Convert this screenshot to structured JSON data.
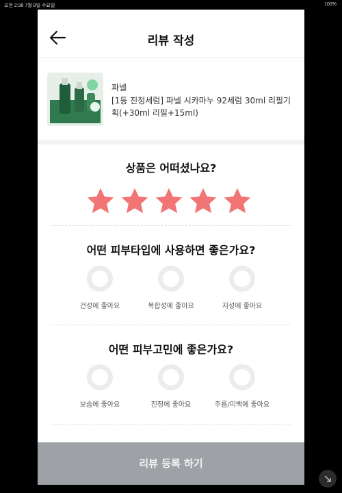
{
  "status_bar": {
    "left": "오전 2:36  7월 8일 수요일",
    "right": "100%"
  },
  "header": {
    "title": "리뷰 작성"
  },
  "product": {
    "brand": "파넬",
    "name": "[1등 진정세럼] 파넬 시카마누 92세럼 30ml 리필기획(+30ml 리필+15ml)"
  },
  "rating": {
    "question": "상품은 어떠셨나요?",
    "stars": 5,
    "filled": 5,
    "star_color": "#f27575"
  },
  "skin_type": {
    "question": "어떤 피부타입에 사용하면 좋은가요?",
    "options": [
      "건성에 좋아요",
      "복합성에 좋아요",
      "지성에 좋아요"
    ]
  },
  "skin_concern": {
    "question": "어떤 피부고민에 좋은가요?",
    "options": [
      "보습에 좋아요",
      "진정에 좋아요",
      "주름/미백에 좋아요"
    ]
  },
  "submit": {
    "label": "리뷰 등록 하기"
  }
}
